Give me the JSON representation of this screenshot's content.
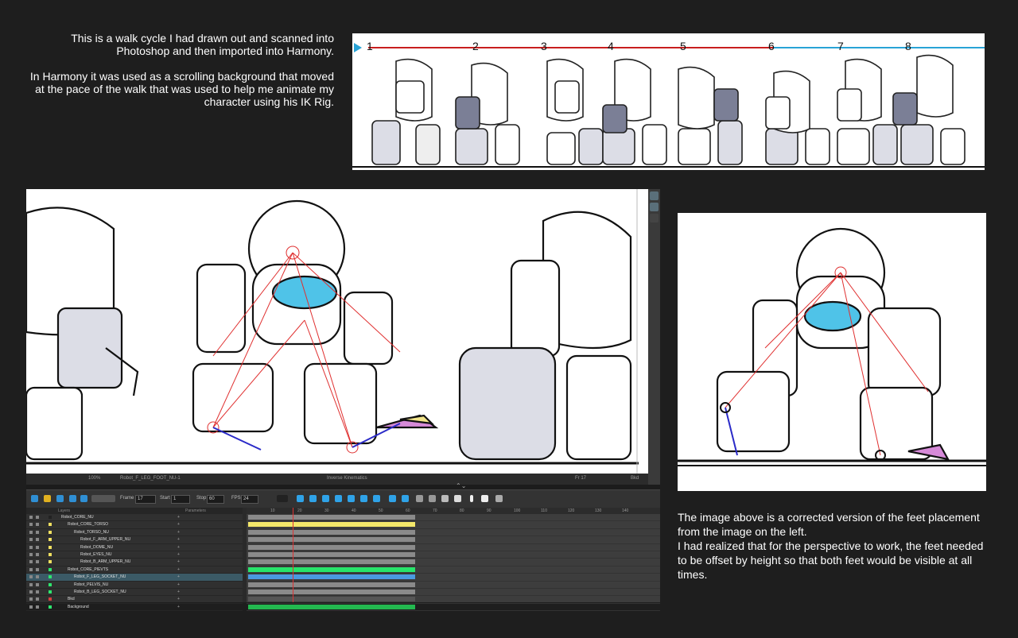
{
  "intro": {
    "paragraph1": "This is a walk cycle I had drawn out and scanned into Photoshop and then imported into Harmony.",
    "paragraph2": "In Harmony it was used as a scrolling background that moved at the pace of the walk that was used to help me animate my character using his IK Rig."
  },
  "walk_strip": {
    "frame_numbers": [
      "1",
      "2",
      "3",
      "4",
      "5",
      "6",
      "7",
      "8"
    ],
    "colors": {
      "red_line": "#c81e1e",
      "blue_line": "#29a3d6"
    }
  },
  "harmony": {
    "viewport_status": {
      "zoom": "100%",
      "node": "Robot_F_LEG_FOOT_NU-1",
      "tool": "Inverse Kinematics",
      "frame_readout": "Fr 17",
      "drawing": "Bkd"
    },
    "timeline_toolbar": {
      "frame_label": "Frame",
      "frame_value": "17",
      "start_label": "Start",
      "start_value": "1",
      "stop_label": "Stop",
      "stop_value": "60",
      "fps_label": "FPS",
      "fps_value": "24"
    },
    "layers_header": {
      "layers": "Layers",
      "parameters": "Parameters"
    },
    "layers": [
      {
        "name": "Robot_CORE_NU",
        "indent": 0,
        "color": "#222222",
        "bar": "#8a8a8a"
      },
      {
        "name": "Robot_CORE_TORSO",
        "indent": 1,
        "color": "#f0e060",
        "bar": "#f4e86a"
      },
      {
        "name": "Robot_TORSO_NU",
        "indent": 2,
        "color": "#f0e060",
        "bar": "#8a8a8a"
      },
      {
        "name": "Robot_F_ARM_UPPER_NU",
        "indent": 3,
        "color": "#f0e060",
        "bar": "#8a8a8a"
      },
      {
        "name": "Robot_DOME_NU",
        "indent": 3,
        "color": "#f0e060",
        "bar": "#8a8a8a"
      },
      {
        "name": "Robot_EYES_NU",
        "indent": 3,
        "color": "#f0e060",
        "bar": "#8a8a8a"
      },
      {
        "name": "Robot_B_ARM_UPPER_NU",
        "indent": 3,
        "color": "#f0e060",
        "bar": "#8a8a8a"
      },
      {
        "name": "Robot_CORE_PIEVTS",
        "indent": 1,
        "color": "#2ee66e",
        "bar": "#27e46a"
      },
      {
        "name": "Robot_F_LEG_SOCKET_NU",
        "indent": 2,
        "color": "#2ee66e",
        "bar": "#4a9ae0",
        "selected": true
      },
      {
        "name": "Robot_PELVIS_NU",
        "indent": 2,
        "color": "#2ee66e",
        "bar": "#8a8a8a"
      },
      {
        "name": "Robot_B_LEG_SOCKET_NU",
        "indent": 2,
        "color": "#2ee66e",
        "bar": "#8a8a8a"
      },
      {
        "name": "Bkd",
        "indent": 1,
        "color": "#d64040",
        "bar": "#555555"
      },
      {
        "name": "Background",
        "indent": 1,
        "color": "#2ee66e",
        "bar": "#23b84f"
      }
    ],
    "ruler_ticks": [
      "10",
      "20",
      "30",
      "40",
      "50",
      "60",
      "70",
      "80",
      "90",
      "100",
      "110",
      "120",
      "130",
      "140"
    ]
  },
  "outro": {
    "line1": "The image above is a corrected version of the feet placement from the image on the left.",
    "line2": "I had realized that for the perspective to work, the feet needed to be offset by height so that both feet would be visible at all times."
  }
}
